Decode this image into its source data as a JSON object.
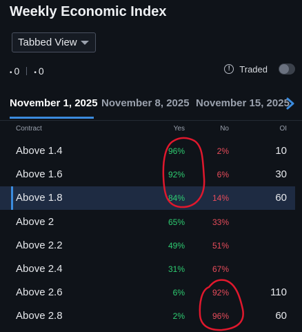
{
  "title": "Weekly Economic Index",
  "view_select": {
    "value": "Tabbed View"
  },
  "counts": {
    "left": "0",
    "right": "0"
  },
  "traded": {
    "label": "Traded",
    "info_glyph": "!",
    "enabled": false
  },
  "tabs": [
    {
      "label": "November 1, 2025",
      "active": true
    },
    {
      "label": "November 8, 2025",
      "active": false
    },
    {
      "label": "November 15, 2025",
      "active": false
    }
  ],
  "table": {
    "columns": {
      "contract": "Contract",
      "yes": "Yes",
      "no": "No",
      "oi": "OI"
    },
    "rows": [
      {
        "contract": "Above 1.4",
        "yes": "96%",
        "no": "2%",
        "oi": "10"
      },
      {
        "contract": "Above 1.6",
        "yes": "92%",
        "no": "6%",
        "oi": "30"
      },
      {
        "contract": "Above 1.8",
        "yes": "84%",
        "no": "14%",
        "oi": "60",
        "selected": true
      },
      {
        "contract": "Above 2",
        "yes": "65%",
        "no": "33%",
        "oi": ""
      },
      {
        "contract": "Above 2.2",
        "yes": "49%",
        "no": "51%",
        "oi": ""
      },
      {
        "contract": "Above 2.4",
        "yes": "31%",
        "no": "67%",
        "oi": ""
      },
      {
        "contract": "Above 2.6",
        "yes": "6%",
        "no": "92%",
        "oi": "110"
      },
      {
        "contract": "Above 2.8",
        "yes": "2%",
        "no": "96%",
        "oi": "60"
      }
    ]
  },
  "colors": {
    "accent": "#3b8bde",
    "yes": "#2ecc71",
    "no": "#e84c5b",
    "annotation": "#e0182d"
  }
}
